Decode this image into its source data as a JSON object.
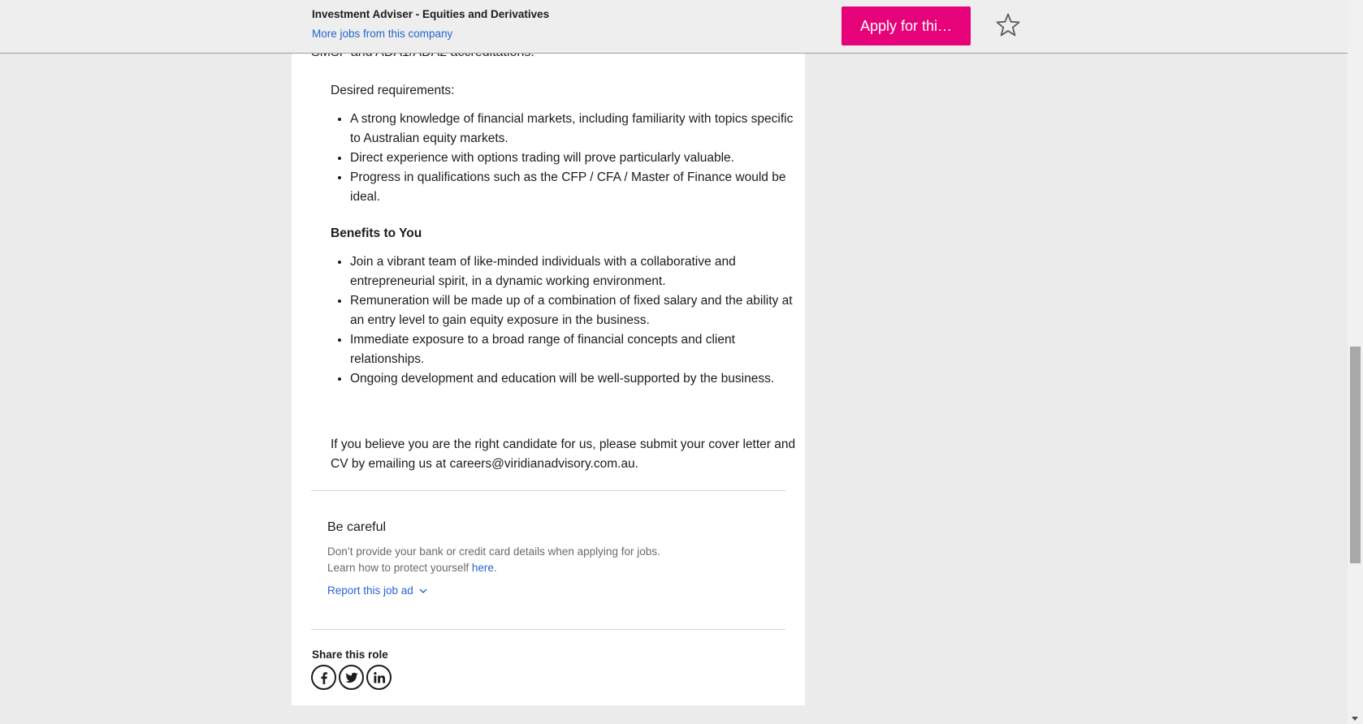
{
  "header": {
    "job_title": "Investment Adviser - Equities and Derivatives",
    "more_jobs_link": "More jobs from this company",
    "apply_button": "Apply for thi…",
    "save_icon": "star-icon"
  },
  "description": {
    "cut_line": "SMSF and ADA1/ADA2 accreditations.",
    "desired_heading": "Desired requirements:",
    "desired_items": [
      "A strong knowledge of financial markets, including familiarity with topics specific to Australian equity markets.",
      "Direct experience with options trading will prove particularly valuable.",
      "Progress in qualifications such as the CFP / CFA / Master of Finance would be ideal."
    ],
    "benefits_heading": "Benefits to You",
    "benefits_items": [
      "Join a vibrant team of like-minded individuals with a collaborative and entrepreneurial spirit, in a dynamic working environment.",
      "Remuneration will be made up of a combination of fixed salary and the ability at an entry level to gain equity exposure in the business.",
      "Immediate exposure to a broad range of financial concepts and client relationships.",
      "Ongoing development and education will be well-supported by the business."
    ],
    "closing": "If you believe you are the right candidate for us, please submit your cover letter and CV by emailing us at careers@viridianadvisory.com.au."
  },
  "careful": {
    "title": "Be careful",
    "line1": "Don’t provide your bank or credit card details when applying for jobs.",
    "line2": "Learn how to protect yourself ",
    "link": "here",
    "line2_end": ".",
    "report": "Report this job ad"
  },
  "share": {
    "title": "Share this role",
    "icons": [
      "facebook-icon",
      "twitter-icon",
      "linkedin-icon"
    ]
  },
  "colors": {
    "accent": "#e60278",
    "link": "#2765cf",
    "background": "#ebebeb"
  }
}
